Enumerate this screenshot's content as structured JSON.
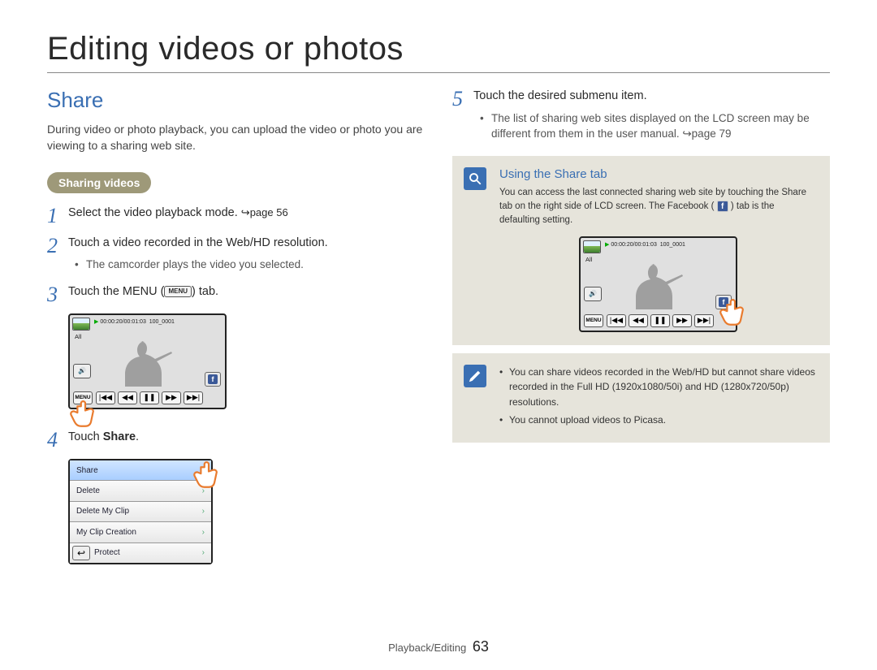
{
  "page_title": "Editing videos or photos",
  "section_title": "Share",
  "intro": "During video or photo playback, you can upload the video or photo you are viewing to a sharing web site.",
  "subsection_pill": "Sharing videos",
  "steps": {
    "s1": {
      "num": "1",
      "text": "Select the video playback mode. ",
      "ref": "↪page 56"
    },
    "s2": {
      "num": "2",
      "text": "Touch a video recorded in the Web/HD resolution.",
      "bullet": "The camcorder plays the video you selected."
    },
    "s3": {
      "num": "3",
      "pre": "Touch the MENU (",
      "menu_label": "MENU",
      "post": ") tab."
    },
    "s4": {
      "num": "4",
      "pre": "Touch ",
      "bold": "Share",
      "post": "."
    },
    "s5": {
      "num": "5",
      "text": "Touch the desired submenu item.",
      "bullet": "The list of sharing web sites displayed on the LCD screen may be different from them in the user manual. ↪page 79"
    }
  },
  "lcd": {
    "timecode": "00:00:20/00:01:03",
    "clipname": "100_0001",
    "all": "All",
    "menu": "MENU",
    "fb": "f"
  },
  "menu_list": {
    "items": [
      "Share",
      "Delete",
      "Delete My Clip",
      "My Clip Creation",
      "Protect"
    ]
  },
  "callout1": {
    "title": "Using the Share tab",
    "body_a": "You can access the last connected sharing web site by touching the Share tab on the right side of LCD screen. The Facebook (",
    "body_b": ") tab is the defaulting setting."
  },
  "callout2": {
    "b1": "You can share videos recorded in the Web/HD but cannot share videos recorded in the Full HD (1920x1080/50i) and HD (1280x720/50p) resolutions.",
    "b2": "You cannot upload videos to Picasa."
  },
  "footer": {
    "section": "Playback/Editing",
    "page": "63"
  }
}
